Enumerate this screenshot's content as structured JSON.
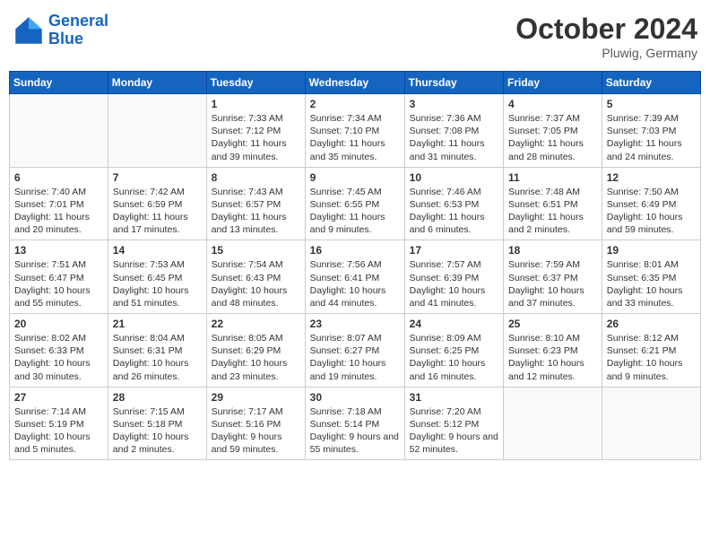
{
  "header": {
    "logo": {
      "line1": "General",
      "line2": "Blue"
    },
    "month": "October 2024",
    "location": "Pluwig, Germany"
  },
  "weekdays": [
    "Sunday",
    "Monday",
    "Tuesday",
    "Wednesday",
    "Thursday",
    "Friday",
    "Saturday"
  ],
  "weeks": [
    [
      {
        "day": "",
        "info": ""
      },
      {
        "day": "",
        "info": ""
      },
      {
        "day": "1",
        "info": "Sunrise: 7:33 AM\nSunset: 7:12 PM\nDaylight: 11 hours and 39 minutes."
      },
      {
        "day": "2",
        "info": "Sunrise: 7:34 AM\nSunset: 7:10 PM\nDaylight: 11 hours and 35 minutes."
      },
      {
        "day": "3",
        "info": "Sunrise: 7:36 AM\nSunset: 7:08 PM\nDaylight: 11 hours and 31 minutes."
      },
      {
        "day": "4",
        "info": "Sunrise: 7:37 AM\nSunset: 7:05 PM\nDaylight: 11 hours and 28 minutes."
      },
      {
        "day": "5",
        "info": "Sunrise: 7:39 AM\nSunset: 7:03 PM\nDaylight: 11 hours and 24 minutes."
      }
    ],
    [
      {
        "day": "6",
        "info": "Sunrise: 7:40 AM\nSunset: 7:01 PM\nDaylight: 11 hours and 20 minutes."
      },
      {
        "day": "7",
        "info": "Sunrise: 7:42 AM\nSunset: 6:59 PM\nDaylight: 11 hours and 17 minutes."
      },
      {
        "day": "8",
        "info": "Sunrise: 7:43 AM\nSunset: 6:57 PM\nDaylight: 11 hours and 13 minutes."
      },
      {
        "day": "9",
        "info": "Sunrise: 7:45 AM\nSunset: 6:55 PM\nDaylight: 11 hours and 9 minutes."
      },
      {
        "day": "10",
        "info": "Sunrise: 7:46 AM\nSunset: 6:53 PM\nDaylight: 11 hours and 6 minutes."
      },
      {
        "day": "11",
        "info": "Sunrise: 7:48 AM\nSunset: 6:51 PM\nDaylight: 11 hours and 2 minutes."
      },
      {
        "day": "12",
        "info": "Sunrise: 7:50 AM\nSunset: 6:49 PM\nDaylight: 10 hours and 59 minutes."
      }
    ],
    [
      {
        "day": "13",
        "info": "Sunrise: 7:51 AM\nSunset: 6:47 PM\nDaylight: 10 hours and 55 minutes."
      },
      {
        "day": "14",
        "info": "Sunrise: 7:53 AM\nSunset: 6:45 PM\nDaylight: 10 hours and 51 minutes."
      },
      {
        "day": "15",
        "info": "Sunrise: 7:54 AM\nSunset: 6:43 PM\nDaylight: 10 hours and 48 minutes."
      },
      {
        "day": "16",
        "info": "Sunrise: 7:56 AM\nSunset: 6:41 PM\nDaylight: 10 hours and 44 minutes."
      },
      {
        "day": "17",
        "info": "Sunrise: 7:57 AM\nSunset: 6:39 PM\nDaylight: 10 hours and 41 minutes."
      },
      {
        "day": "18",
        "info": "Sunrise: 7:59 AM\nSunset: 6:37 PM\nDaylight: 10 hours and 37 minutes."
      },
      {
        "day": "19",
        "info": "Sunrise: 8:01 AM\nSunset: 6:35 PM\nDaylight: 10 hours and 33 minutes."
      }
    ],
    [
      {
        "day": "20",
        "info": "Sunrise: 8:02 AM\nSunset: 6:33 PM\nDaylight: 10 hours and 30 minutes."
      },
      {
        "day": "21",
        "info": "Sunrise: 8:04 AM\nSunset: 6:31 PM\nDaylight: 10 hours and 26 minutes."
      },
      {
        "day": "22",
        "info": "Sunrise: 8:05 AM\nSunset: 6:29 PM\nDaylight: 10 hours and 23 minutes."
      },
      {
        "day": "23",
        "info": "Sunrise: 8:07 AM\nSunset: 6:27 PM\nDaylight: 10 hours and 19 minutes."
      },
      {
        "day": "24",
        "info": "Sunrise: 8:09 AM\nSunset: 6:25 PM\nDaylight: 10 hours and 16 minutes."
      },
      {
        "day": "25",
        "info": "Sunrise: 8:10 AM\nSunset: 6:23 PM\nDaylight: 10 hours and 12 minutes."
      },
      {
        "day": "26",
        "info": "Sunrise: 8:12 AM\nSunset: 6:21 PM\nDaylight: 10 hours and 9 minutes."
      }
    ],
    [
      {
        "day": "27",
        "info": "Sunrise: 7:14 AM\nSunset: 5:19 PM\nDaylight: 10 hours and 5 minutes."
      },
      {
        "day": "28",
        "info": "Sunrise: 7:15 AM\nSunset: 5:18 PM\nDaylight: 10 hours and 2 minutes."
      },
      {
        "day": "29",
        "info": "Sunrise: 7:17 AM\nSunset: 5:16 PM\nDaylight: 9 hours and 59 minutes."
      },
      {
        "day": "30",
        "info": "Sunrise: 7:18 AM\nSunset: 5:14 PM\nDaylight: 9 hours and 55 minutes."
      },
      {
        "day": "31",
        "info": "Sunrise: 7:20 AM\nSunset: 5:12 PM\nDaylight: 9 hours and 52 minutes."
      },
      {
        "day": "",
        "info": ""
      },
      {
        "day": "",
        "info": ""
      }
    ]
  ]
}
